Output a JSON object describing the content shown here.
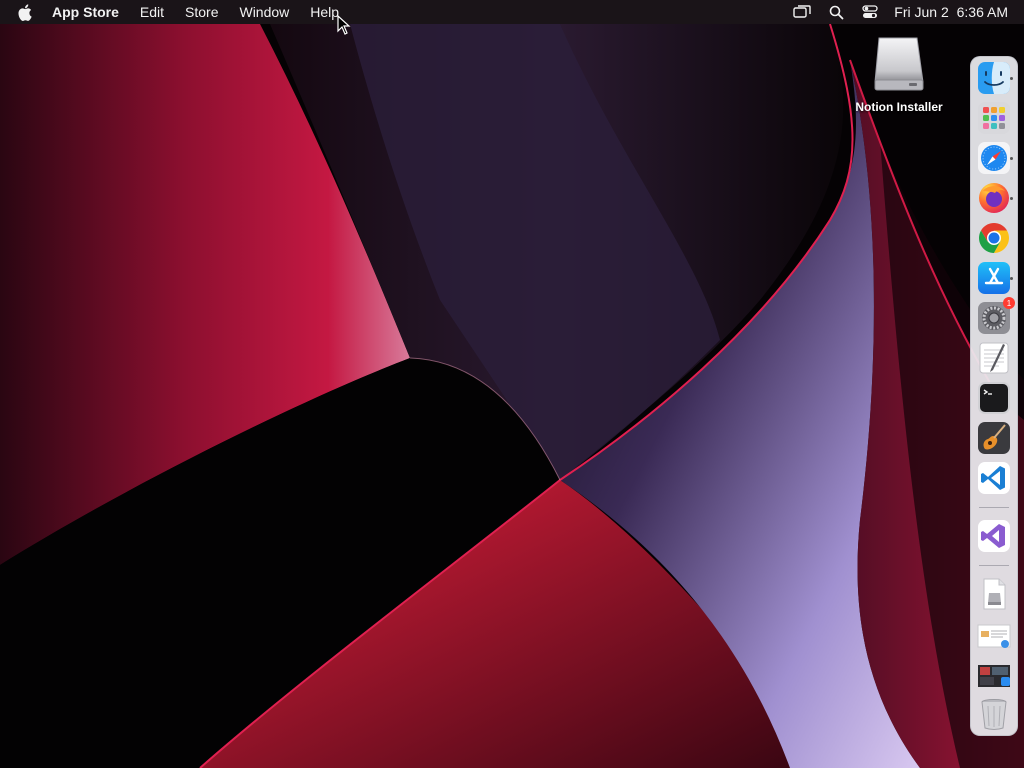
{
  "menubar": {
    "app_name": "App Store",
    "menus": [
      "Edit",
      "Store",
      "Window",
      "Help"
    ],
    "clock": {
      "date": "Fri Jun 2",
      "time": "6:36 AM"
    },
    "status_icons": [
      "screen-mirroring-icon",
      "search-icon",
      "control-center-icon"
    ]
  },
  "desktop": {
    "items": [
      {
        "label": "Notion Installer",
        "icon": "external-disk-icon"
      }
    ]
  },
  "dock": {
    "apps": [
      {
        "name": "Finder",
        "icon": "finder-icon",
        "running": true
      },
      {
        "name": "Launchpad",
        "icon": "launchpad-icon",
        "running": false
      },
      {
        "name": "Safari",
        "icon": "safari-icon",
        "running": true
      },
      {
        "name": "Firefox",
        "icon": "firefox-icon",
        "running": true
      },
      {
        "name": "Google Chrome",
        "icon": "chrome-icon",
        "running": false
      },
      {
        "name": "App Store",
        "icon": "app-store-icon",
        "running": true
      },
      {
        "name": "System Settings",
        "icon": "system-settings-icon",
        "running": false,
        "badge": "1"
      },
      {
        "name": "TextEdit",
        "icon": "textedit-icon",
        "running": false
      },
      {
        "name": "Terminal",
        "icon": "terminal-icon",
        "running": false
      },
      {
        "name": "GarageBand",
        "icon": "garageband-icon",
        "running": false
      },
      {
        "name": "Visual Studio Code",
        "icon": "vscode-icon",
        "running": false
      }
    ],
    "recent": [
      {
        "name": "Visual Studio",
        "icon": "visual-studio-icon"
      }
    ],
    "stacks": [
      {
        "name": "Notion Installer",
        "icon": "dmg-file-icon"
      },
      {
        "name": "Documents",
        "icon": "documents-stack-icon"
      },
      {
        "name": "Downloads",
        "icon": "downloads-stack-icon"
      },
      {
        "name": "Trash",
        "icon": "trash-icon"
      }
    ]
  },
  "colors": {
    "menubar_bg": "#1c161a",
    "wallpaper_red": "#b0123a",
    "wallpaper_violet": "#8c7ab8",
    "dock_bg": "#ececf0"
  }
}
